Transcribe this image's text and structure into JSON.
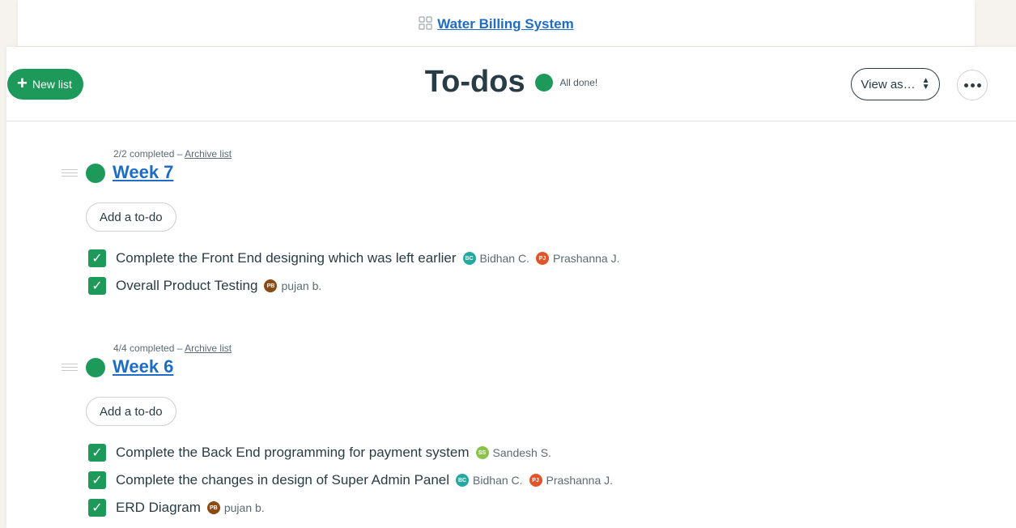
{
  "breadcrumb": {
    "project": "Water Billing System"
  },
  "header": {
    "new_list": "New list",
    "title": "To-dos",
    "status": "All done!",
    "view_as": "View as…",
    "colors": {
      "accent": "#1d9a5a",
      "link": "#1d6dc6"
    }
  },
  "lists": [
    {
      "meta": "2/2 completed –",
      "archive": "Archive list",
      "title": "Week 7",
      "add_label": "Add a to-do",
      "todos": [
        {
          "text": "Complete the Front End designing which was left earlier",
          "assignees": [
            {
              "initials": "BC",
              "name": "Bidhan C.",
              "color": "#23a9a2"
            },
            {
              "initials": "PJ",
              "name": "Prashanna J.",
              "color": "#e0552a"
            }
          ]
        },
        {
          "text": "Overall Product Testing",
          "assignees": [
            {
              "initials": "PB",
              "name": "pujan b.",
              "color": "#8a4a12"
            }
          ]
        }
      ]
    },
    {
      "meta": "4/4 completed –",
      "archive": "Archive list",
      "title": "Week 6",
      "add_label": "Add a to-do",
      "todos": [
        {
          "text": "Complete the Back End programming for payment system",
          "assignees": [
            {
              "initials": "SS",
              "name": "Sandesh S.",
              "color": "#8bc34a"
            }
          ]
        },
        {
          "text": "Complete the changes in design of Super Admin Panel",
          "assignees": [
            {
              "initials": "BC",
              "name": "Bidhan C.",
              "color": "#23a9a2"
            },
            {
              "initials": "PJ",
              "name": "Prashanna J.",
              "color": "#e0552a"
            }
          ]
        },
        {
          "text": "ERD Diagram",
          "assignees": [
            {
              "initials": "PB",
              "name": "pujan b.",
              "color": "#8a4a12"
            }
          ]
        }
      ]
    }
  ]
}
